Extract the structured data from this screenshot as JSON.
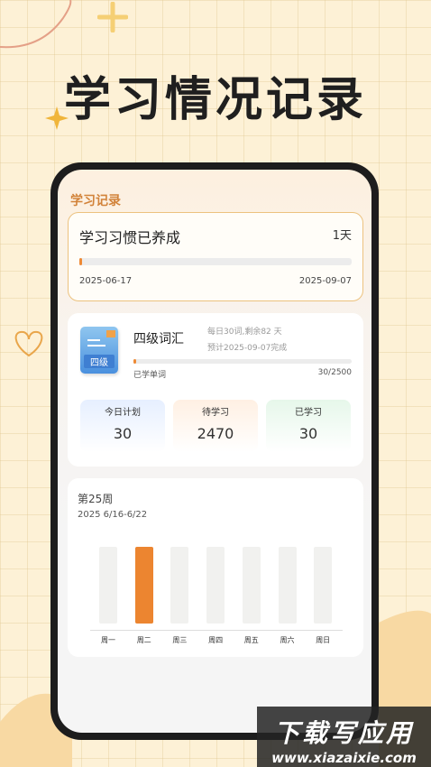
{
  "headline": "学习情况记录",
  "screen": {
    "title": "学习记录",
    "habit_card": {
      "title": "学习习惯已养成",
      "days": "1天",
      "progress": 0.01,
      "start_date": "2025-06-17",
      "end_date": "2025-09-07"
    },
    "vocab_card": {
      "book_label": "四级",
      "name": "四级词汇",
      "daily": "每日30词,剩余82 天",
      "estimate": "预计2025-09-07完成",
      "learned_label": "已学单词",
      "learned_count": "30/2500",
      "progress": 0.012,
      "stats": [
        {
          "label": "今日计划",
          "value": "30"
        },
        {
          "label": "待学习",
          "value": "2470"
        },
        {
          "label": "已学习",
          "value": "30"
        }
      ]
    },
    "week_card": {
      "week": "第25周",
      "range": "2025 6/16-6/22",
      "days": [
        "周一",
        "周二",
        "周三",
        "周四",
        "周五",
        "周六",
        "周日"
      ],
      "values": [
        0,
        1,
        0,
        0,
        0,
        0,
        0
      ]
    }
  },
  "watermark": {
    "line1": "下载写应用",
    "line2": "www.xiazaixie.com"
  },
  "colors": {
    "accent": "#ee8a35",
    "title_orange": "#d2833a",
    "background": "#fdf1d6"
  }
}
